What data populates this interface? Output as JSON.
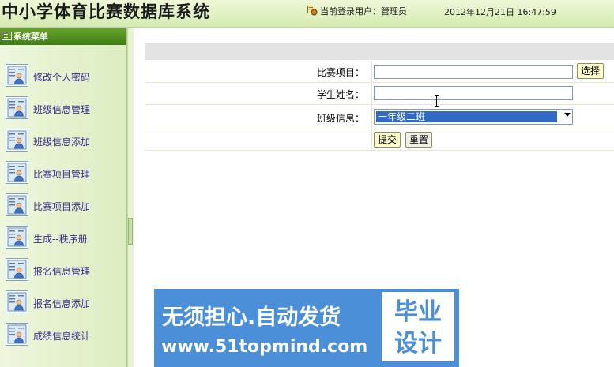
{
  "header": {
    "app_title": "中小学体育比赛数据库系统",
    "current_user_text": "当前登录用户：管理员",
    "datetime": "2012年12月21日  16:47:59"
  },
  "sidebar": {
    "title": "系统菜单",
    "items": [
      {
        "label": "修改个人密码"
      },
      {
        "label": "班级信息管理"
      },
      {
        "label": "班级信息添加"
      },
      {
        "label": "比赛项目管理"
      },
      {
        "label": "比赛项目添加"
      },
      {
        "label": "生成--秩序册"
      },
      {
        "label": "报名信息管理"
      },
      {
        "label": "报名信息添加"
      },
      {
        "label": "成绩信息统计"
      }
    ]
  },
  "form": {
    "event_label": "比赛项目：",
    "event_value": "",
    "choose_button": "选择",
    "student_label": "学生姓名：",
    "student_value": "",
    "class_label": "班级信息：",
    "class_selected": "一年级二班",
    "submit_button": "提交",
    "reset_button": "重置"
  },
  "watermark": {
    "slogan": "无须担心.自动发货",
    "url": "www.51topmind.com",
    "badge_line1": "毕业",
    "badge_line2": "设计"
  },
  "colors": {
    "header_bg": "#d4ebb0",
    "menu_header_bg": "#4e8a1e",
    "menu_text": "#3a2d8f",
    "selected_bg": "#3169c6",
    "watermark_bg": "#4a8fd8"
  }
}
